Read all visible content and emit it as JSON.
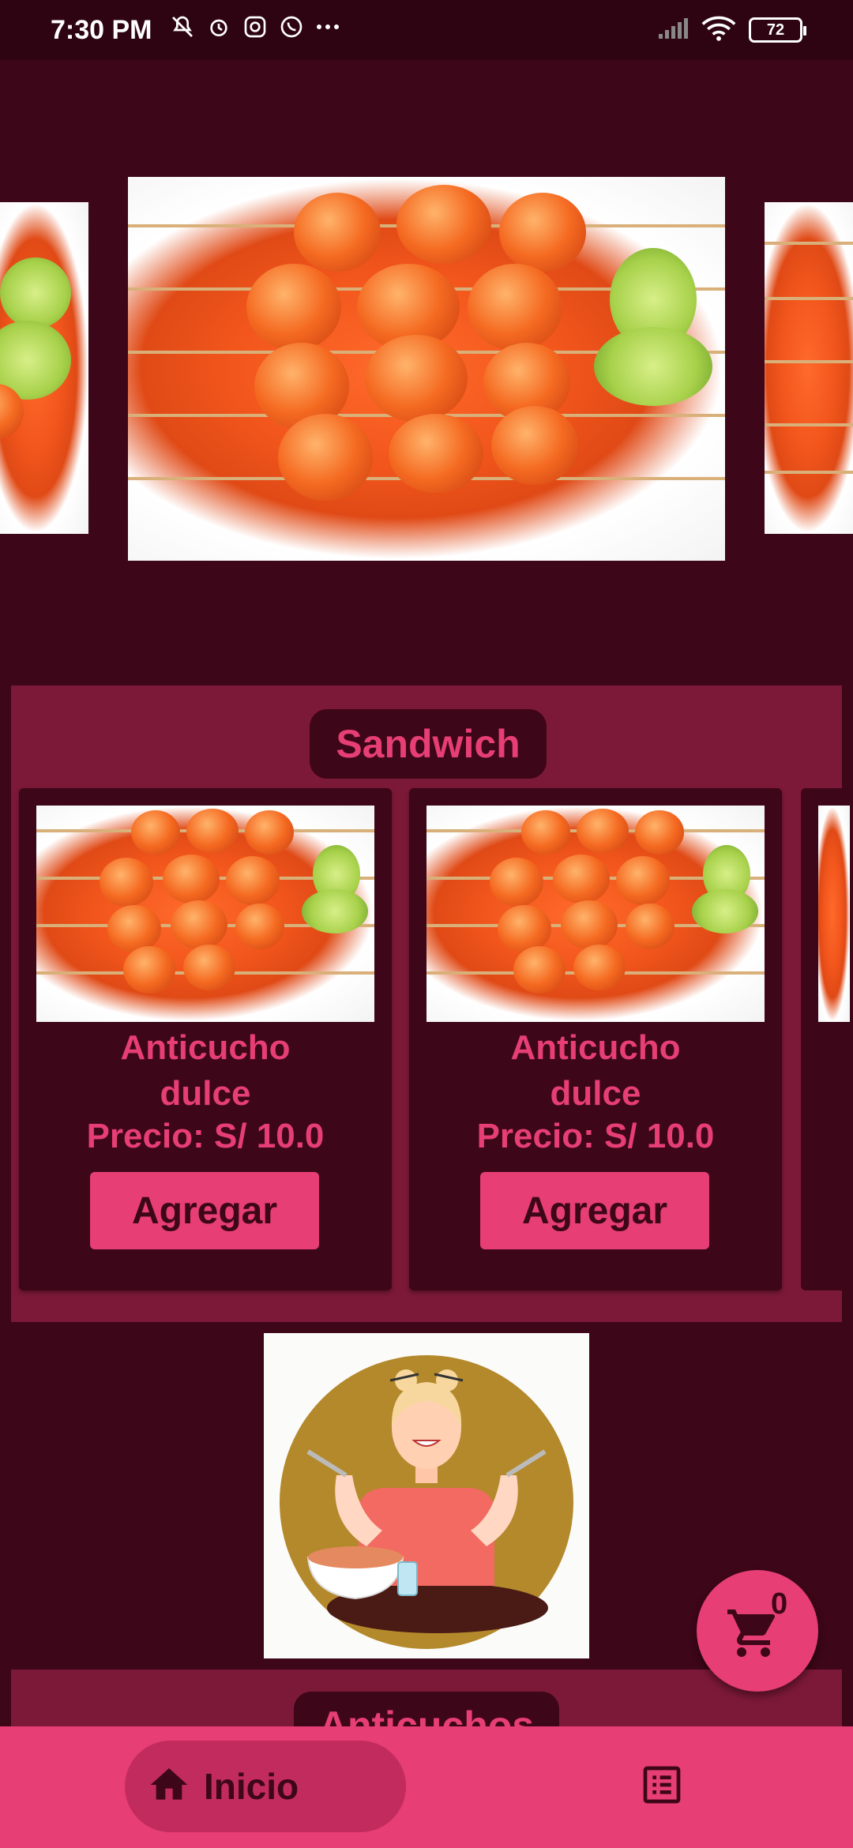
{
  "status_bar": {
    "time": "7:30 PM",
    "battery": "72",
    "left_icons": [
      "bell-off-icon",
      "alarm-icon",
      "instagram-icon",
      "whatsapp-icon",
      "more-dots-icon"
    ],
    "right_icons": [
      "signal-icon",
      "wifi-icon",
      "battery-icon"
    ]
  },
  "carousel": {
    "items": [
      {
        "name": "shrimp-skewers-image"
      },
      {
        "name": "shrimp-skewers-image"
      },
      {
        "name": "shrimp-skewers-image"
      }
    ]
  },
  "sandwich_section": {
    "title": "Sandwich",
    "products": [
      {
        "name_line1": "Anticucho",
        "name_line2": "dulce",
        "price": "Precio: S/ 10.0",
        "button": "Agregar"
      },
      {
        "name_line1": "Anticucho",
        "name_line2": "dulce",
        "price": "Precio: S/ 10.0",
        "button": "Agregar"
      }
    ]
  },
  "next_section": {
    "title": "Anticuchos"
  },
  "cart": {
    "count": "0",
    "icon": "cart-icon"
  },
  "bottom_nav": {
    "home_label": "Inicio",
    "home_icon": "home-icon",
    "menu_icon": "list-icon"
  },
  "colors": {
    "background": "#3d0619",
    "section": "#7d1938",
    "accent": "#e63e75"
  }
}
